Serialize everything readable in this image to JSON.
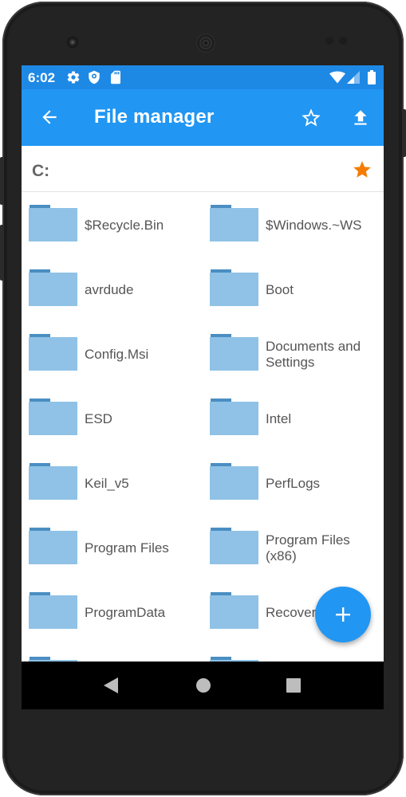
{
  "status_bar": {
    "time": "6:02",
    "left_icons": [
      "gear-icon",
      "shield-icon",
      "sd-card-icon"
    ],
    "right_icons": [
      "wifi-icon",
      "signal-icon",
      "battery-icon"
    ]
  },
  "app_bar": {
    "title": "File manager",
    "back_icon": "arrow-left-icon",
    "actions": [
      "star-outline-icon",
      "upload-icon"
    ]
  },
  "path_bar": {
    "path": "C:",
    "favorite_icon": "star-filled-icon"
  },
  "folders": [
    {
      "label": "$Recycle.Bin"
    },
    {
      "label": "$Windows.~WS"
    },
    {
      "label": "avrdude"
    },
    {
      "label": "Boot"
    },
    {
      "label": "Config.Msi"
    },
    {
      "label": "Documents and Settings"
    },
    {
      "label": "ESD"
    },
    {
      "label": "Intel"
    },
    {
      "label": "Keil_v5"
    },
    {
      "label": "PerfLogs"
    },
    {
      "label": "Program Files"
    },
    {
      "label": "Program Files (x86)"
    },
    {
      "label": "ProgramData"
    },
    {
      "label": "Recover"
    },
    {
      "label": ""
    },
    {
      "label": ""
    }
  ],
  "fab": {
    "icon": "plus-icon"
  },
  "nav_bar": {
    "buttons": [
      "back-triangle-icon",
      "home-circle-icon",
      "recents-square-icon"
    ]
  },
  "colors": {
    "status_bar": "#1e88e5",
    "app_bar": "#2196f3",
    "folder": "#8fc2e6",
    "folder_tab": "#4a8ec2",
    "favorite_star": "#f57c00",
    "text": "#555555"
  }
}
